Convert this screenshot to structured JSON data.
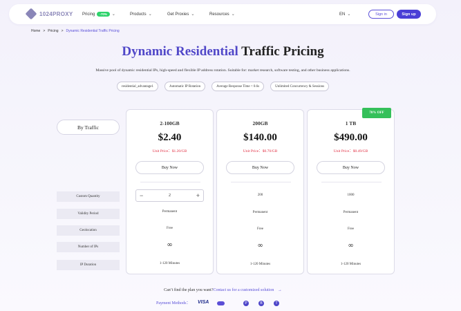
{
  "nav": {
    "logo_text": "1024PROXY",
    "items": [
      {
        "label": "Pricing",
        "badge": "-70%"
      },
      {
        "label": "Products"
      },
      {
        "label": "Get Proxies"
      },
      {
        "label": "Resources"
      }
    ],
    "lang": "EN",
    "signin": "Sign in",
    "signup": "Sign up"
  },
  "breadcrumb": {
    "home": "Home",
    "pricing": "Pricing",
    "current": "Dynamic Residential Traffic Pricing",
    "sep": ">"
  },
  "title": {
    "accent": "Dynamic Residential",
    "rest": " Traffic Pricing"
  },
  "subtitle": "Massive pool of dynamic residential IPs, high-speed and flexible IP address rotation. Suitable for: market research, software testing, and other business applications.",
  "tags": [
    "residential_advantage1",
    "Automatic IP Rotation",
    "Average Response Time < 0.6s",
    "Unlimited Concurrency & Sessions"
  ],
  "by_traffic": "By Traffic",
  "row_labels": [
    "Custom Quantity",
    "Validity Period",
    "Geolocation",
    "Number of IPs",
    "IP Duration"
  ],
  "cards": [
    {
      "name": "2-100GB",
      "price": "$2.40",
      "unit_price": "Unit Price：$1.20/GB",
      "buy": "Buy Now",
      "quantity": "2",
      "validity": "Permanent",
      "geo": "Free",
      "ips": "∞",
      "duration": "1-120 Minutes",
      "badge": ""
    },
    {
      "name": "200GB",
      "price": "$140.00",
      "unit_price": "Unit Price：$0.70/GB",
      "buy": "Buy Now",
      "quantity": "200",
      "validity": "Permanent",
      "geo": "Free",
      "ips": "∞",
      "duration": "1-120 Minutes",
      "badge": ""
    },
    {
      "name": "1 TB",
      "price": "$490.00",
      "unit_price": "Unit Price：$0.49/GB",
      "buy": "Buy Now",
      "quantity": "1000",
      "validity": "Permanent",
      "geo": "Free",
      "ips": "∞",
      "duration": "1-120 Minutes",
      "badge": "70% OFF"
    }
  ],
  "stepper": {
    "minus": "−",
    "plus": "+"
  },
  "footer": {
    "cant_find": "Can’t find the plan you want?",
    "contact": "Contact us for a customized solution",
    "arrow": "→",
    "payment_label": "Payment Methods：",
    "visa": "VISA"
  },
  "colors": {
    "accent": "#5047c8",
    "unit_price": "#e02a3e",
    "badge": "#35c05a"
  }
}
